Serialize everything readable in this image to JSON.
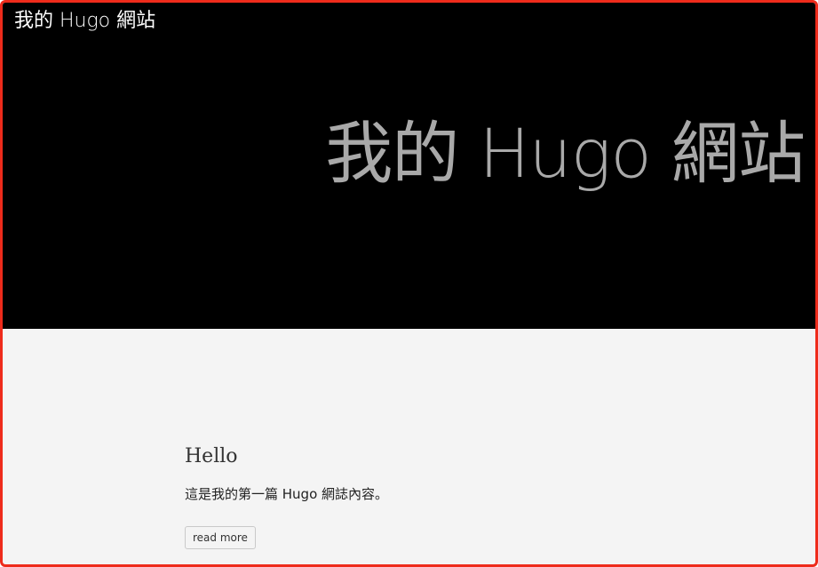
{
  "header": {
    "site_title": "我的 Hugo 網站",
    "hero_heading": "我的 Hugo 網站"
  },
  "posts": [
    {
      "title": "Hello",
      "summary": "這是我的第一篇 Hugo 網誌內容。",
      "read_more_label": "read more"
    }
  ],
  "colors": {
    "hero_background": "#000000",
    "hero_heading": "#a9a9a9",
    "site_title": "#ffffff",
    "page_background": "#f4f4f4",
    "window_border": "#ee2b1b"
  }
}
